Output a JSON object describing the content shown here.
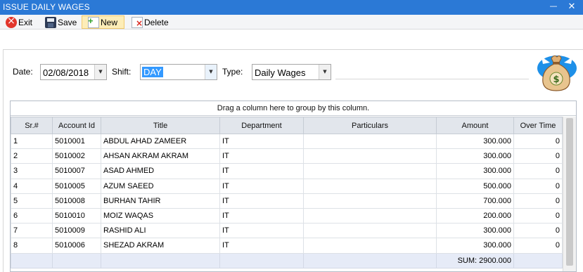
{
  "window": {
    "title": "ISSUE DAILY WAGES"
  },
  "toolbar": {
    "exit_label": "Exit",
    "save_label": "Save",
    "new_label": "New",
    "delete_label": "Delete"
  },
  "form": {
    "date_label": "Date:",
    "date_value": "02/08/2018",
    "shift_label": "Shift:",
    "shift_value": "DAY",
    "type_label": "Type:",
    "type_value": "Daily Wages"
  },
  "grid": {
    "group_hint": "Drag a column here to group by this column.",
    "columns": [
      "Sr.#",
      "Account Id",
      "Title",
      "Department",
      "Particulars",
      "Amount",
      "Over Time"
    ],
    "rows": [
      {
        "sr": "1",
        "account_id": "5010001",
        "title": "ABDUL AHAD ZAMEER",
        "department": "IT",
        "particulars": "",
        "amount": "300.000",
        "overtime": "0"
      },
      {
        "sr": "2",
        "account_id": "5010002",
        "title": "AHSAN AKRAM AKRAM",
        "department": "IT",
        "particulars": "",
        "amount": "300.000",
        "overtime": "0"
      },
      {
        "sr": "3",
        "account_id": "5010007",
        "title": "ASAD AHMED",
        "department": "IT",
        "particulars": "",
        "amount": "300.000",
        "overtime": "0"
      },
      {
        "sr": "4",
        "account_id": "5010005",
        "title": "AZUM SAEED",
        "department": "IT",
        "particulars": "",
        "amount": "500.000",
        "overtime": "0"
      },
      {
        "sr": "5",
        "account_id": "5010008",
        "title": "BURHAN TAHIR",
        "department": "IT",
        "particulars": "",
        "amount": "700.000",
        "overtime": "0"
      },
      {
        "sr": "6",
        "account_id": "5010010",
        "title": "MOIZ WAQAS",
        "department": "IT",
        "particulars": "",
        "amount": "200.000",
        "overtime": "0"
      },
      {
        "sr": "7",
        "account_id": "5010009",
        "title": "RASHID ALI",
        "department": "IT",
        "particulars": "",
        "amount": "300.000",
        "overtime": "0"
      },
      {
        "sr": "8",
        "account_id": "5010006",
        "title": "SHEZAD AKRAM",
        "department": "IT",
        "particulars": "",
        "amount": "300.000",
        "overtime": "0"
      }
    ],
    "footer_sum": "SUM: 2900.000"
  },
  "icons": {
    "titlebar_minimize": "minimize-icon",
    "titlebar_close": "close-icon",
    "form_image": "money-bag-icon",
    "money_symbol": "$"
  },
  "colors": {
    "titlebar": "#2b79d6",
    "selection": "#3399ff",
    "new_button": "#fdedb8",
    "footer_row": "#e6ebf7"
  }
}
